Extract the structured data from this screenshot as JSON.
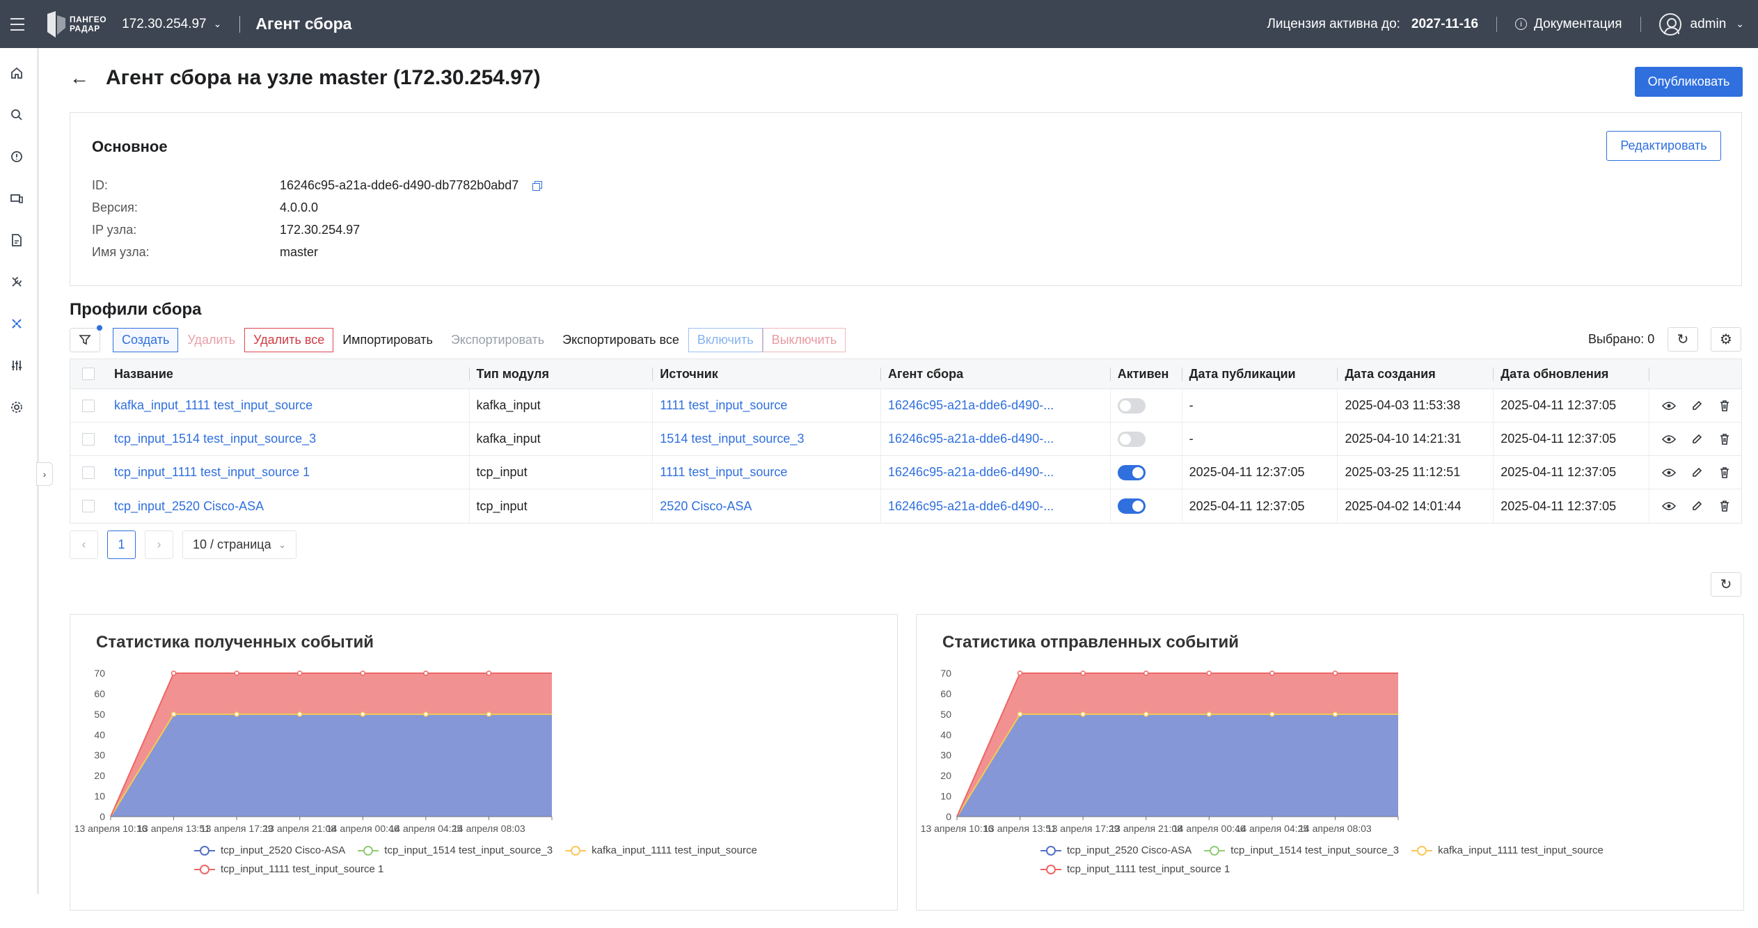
{
  "topbar": {
    "logo_line1": "ПАНГЕО",
    "logo_line2": "РАДАР",
    "host": "172.30.254.97",
    "app_title": "Агент сбора",
    "license_label": "Лицензия активна до:",
    "license_date": "2027-11-16",
    "docs_label": "Документация",
    "user": "admin"
  },
  "page": {
    "title": "Агент сбора на узле master (172.30.254.97)",
    "publish_label": "Опубликовать"
  },
  "main_card": {
    "title": "Основное",
    "edit_label": "Редактировать",
    "fields": [
      {
        "key": "ID:",
        "value": "16246c95-a21a-dde6-d490-db7782b0abd7"
      },
      {
        "key": "Версия:",
        "value": "4.0.0.0"
      },
      {
        "key": "IP узла:",
        "value": "172.30.254.97"
      },
      {
        "key": "Имя узла:",
        "value": "master"
      }
    ]
  },
  "profiles": {
    "title": "Профили сбора",
    "toolbar": {
      "create": "Создать",
      "delete": "Удалить",
      "delete_all": "Удалить все",
      "import": "Импортировать",
      "export": "Экспортировать",
      "export_all": "Экспортировать все",
      "enable": "Включить",
      "disable": "Выключить"
    },
    "selected": "Выбрано: 0",
    "columns": {
      "name": "Название",
      "type": "Тип модуля",
      "source": "Источник",
      "agent": "Агент сбора",
      "active": "Активен",
      "published": "Дата публикации",
      "created": "Дата создания",
      "updated": "Дата обновления"
    },
    "rows": [
      {
        "name": "kafka_input_1111 test_input_source",
        "type": "kafka_input",
        "source": "1111 test_input_source",
        "agent": "16246c95-a21a-dde6-d490-...",
        "active": false,
        "published": "-",
        "created": "2025-04-03 11:53:38",
        "updated": "2025-04-11 12:37:05"
      },
      {
        "name": "tcp_input_1514 test_input_source_3",
        "type": "kafka_input",
        "source": "1514 test_input_source_3",
        "agent": "16246c95-a21a-dde6-d490-...",
        "active": false,
        "published": "-",
        "created": "2025-04-10 14:21:31",
        "updated": "2025-04-11 12:37:05"
      },
      {
        "name": "tcp_input_1111 test_input_source 1",
        "type": "tcp_input",
        "source": "1111 test_input_source",
        "agent": "16246c95-a21a-dde6-d490-...",
        "active": true,
        "published": "2025-04-11 12:37:05",
        "created": "2025-03-25 11:12:51",
        "updated": "2025-04-11 12:37:05"
      },
      {
        "name": "tcp_input_2520 Cisco-ASA",
        "type": "tcp_input",
        "source": "2520 Cisco-ASA",
        "agent": "16246c95-a21a-dde6-d490-...",
        "active": true,
        "published": "2025-04-11 12:37:05",
        "created": "2025-04-02 14:01:44",
        "updated": "2025-04-11 12:37:05"
      }
    ],
    "pagination": {
      "current_page": "1",
      "page_size": "10 / страница"
    }
  },
  "chart_data": [
    {
      "type": "area",
      "title": "Статистика полученных событий",
      "x": [
        "13 апреля 10:16",
        "13 апреля 13:51",
        "13 апреля 17:29",
        "13 апреля 21:08",
        "14 апреля 00:46",
        "14 апреля 04:25",
        "14 апреля 08:03",
        ""
      ],
      "ylim": [
        0,
        70
      ],
      "yticks": [
        0,
        10,
        20,
        30,
        40,
        50,
        60,
        70
      ],
      "stacked": true,
      "series": [
        {
          "name": "tcp_input_2520 Cisco-ASA",
          "color": "#5470c6",
          "values": [
            0,
            50,
            50,
            50,
            50,
            50,
            50,
            50
          ]
        },
        {
          "name": "tcp_input_1514 test_input_source_3",
          "color": "#91cc75",
          "values": [
            0,
            0,
            0,
            0,
            0,
            0,
            0,
            0
          ]
        },
        {
          "name": "kafka_input_1111 test_input_source",
          "color": "#fac858",
          "values": [
            0,
            0,
            0,
            0,
            0,
            0,
            0,
            0
          ]
        },
        {
          "name": "tcp_input_1111 test_input_source 1",
          "color": "#ee6666",
          "values": [
            0,
            20,
            20,
            20,
            20,
            20,
            20,
            20
          ]
        }
      ]
    },
    {
      "type": "area",
      "title": "Статистика отправленных событий",
      "x": [
        "13 апреля 10:16",
        "13 апреля 13:51",
        "13 апреля 17:29",
        "13 апреля 21:08",
        "14 апреля 00:46",
        "14 апреля 04:25",
        "14 апреля 08:03",
        ""
      ],
      "ylim": [
        0,
        70
      ],
      "yticks": [
        0,
        10,
        20,
        30,
        40,
        50,
        60,
        70
      ],
      "stacked": true,
      "series": [
        {
          "name": "tcp_input_2520 Cisco-ASA",
          "color": "#5470c6",
          "values": [
            0,
            50,
            50,
            50,
            50,
            50,
            50,
            50
          ]
        },
        {
          "name": "tcp_input_1514 test_input_source_3",
          "color": "#91cc75",
          "values": [
            0,
            0,
            0,
            0,
            0,
            0,
            0,
            0
          ]
        },
        {
          "name": "kafka_input_1111 test_input_source",
          "color": "#fac858",
          "values": [
            0,
            0,
            0,
            0,
            0,
            0,
            0,
            0
          ]
        },
        {
          "name": "tcp_input_1111 test_input_source 1",
          "color": "#ee6666",
          "values": [
            0,
            20,
            20,
            20,
            20,
            20,
            20,
            20
          ]
        }
      ]
    }
  ]
}
